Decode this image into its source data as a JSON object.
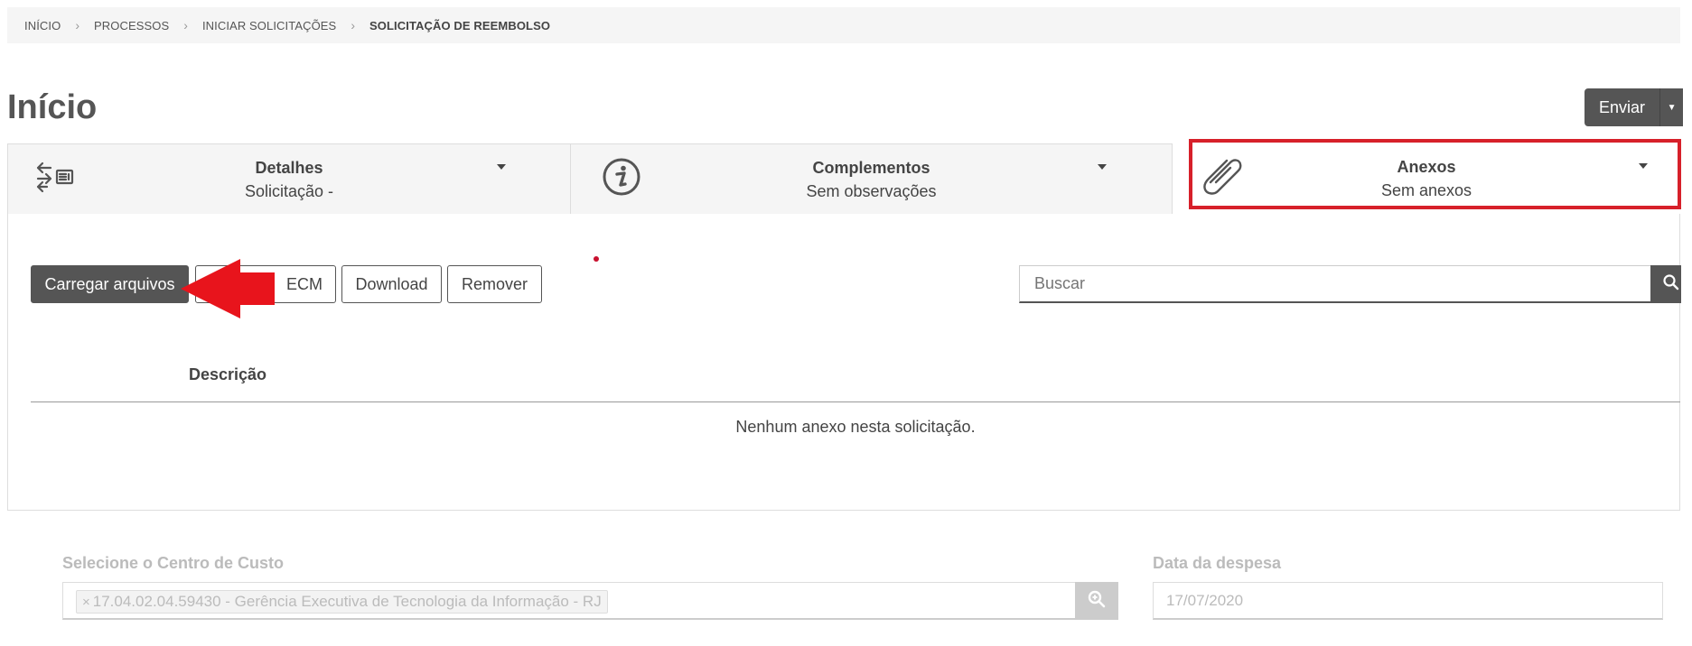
{
  "breadcrumb": {
    "items": [
      "INÍCIO",
      "PROCESSOS",
      "INICIAR SOLICITAÇÕES",
      "SOLICITAÇÃO DE REEMBOLSO"
    ]
  },
  "page": {
    "title": "Início"
  },
  "actions": {
    "send_label": "Enviar"
  },
  "tabs": [
    {
      "title": "Detalhes",
      "subtitle": "Solicitação -",
      "icon": "transfer-list-icon"
    },
    {
      "title": "Complementos",
      "subtitle": "Sem observações",
      "icon": "info-icon"
    },
    {
      "title": "Anexos",
      "subtitle": "Sem anexos",
      "icon": "paperclip-icon",
      "highlighted": true
    }
  ],
  "attachments": {
    "upload_label": "Carregar arquivos",
    "ecm_label": "ECM",
    "download_label": "Download",
    "remove_label": "Remover",
    "search_placeholder": "Buscar",
    "column_description": "Descrição",
    "empty_message": "Nenhum anexo nesta solicitação."
  },
  "form": {
    "cost_center_label": "Selecione o Centro de Custo",
    "cost_center_value": "17.04.02.04.59430 - Gerência Executiva de Tecnologia da Informação - RJ",
    "cost_center_remove": "×",
    "expense_date_label": "Data da despesa",
    "expense_date_value": "17/07/2020"
  },
  "colors": {
    "highlight": "#d7202a",
    "arrow": "#e8141c",
    "primary_button": "#555555"
  }
}
